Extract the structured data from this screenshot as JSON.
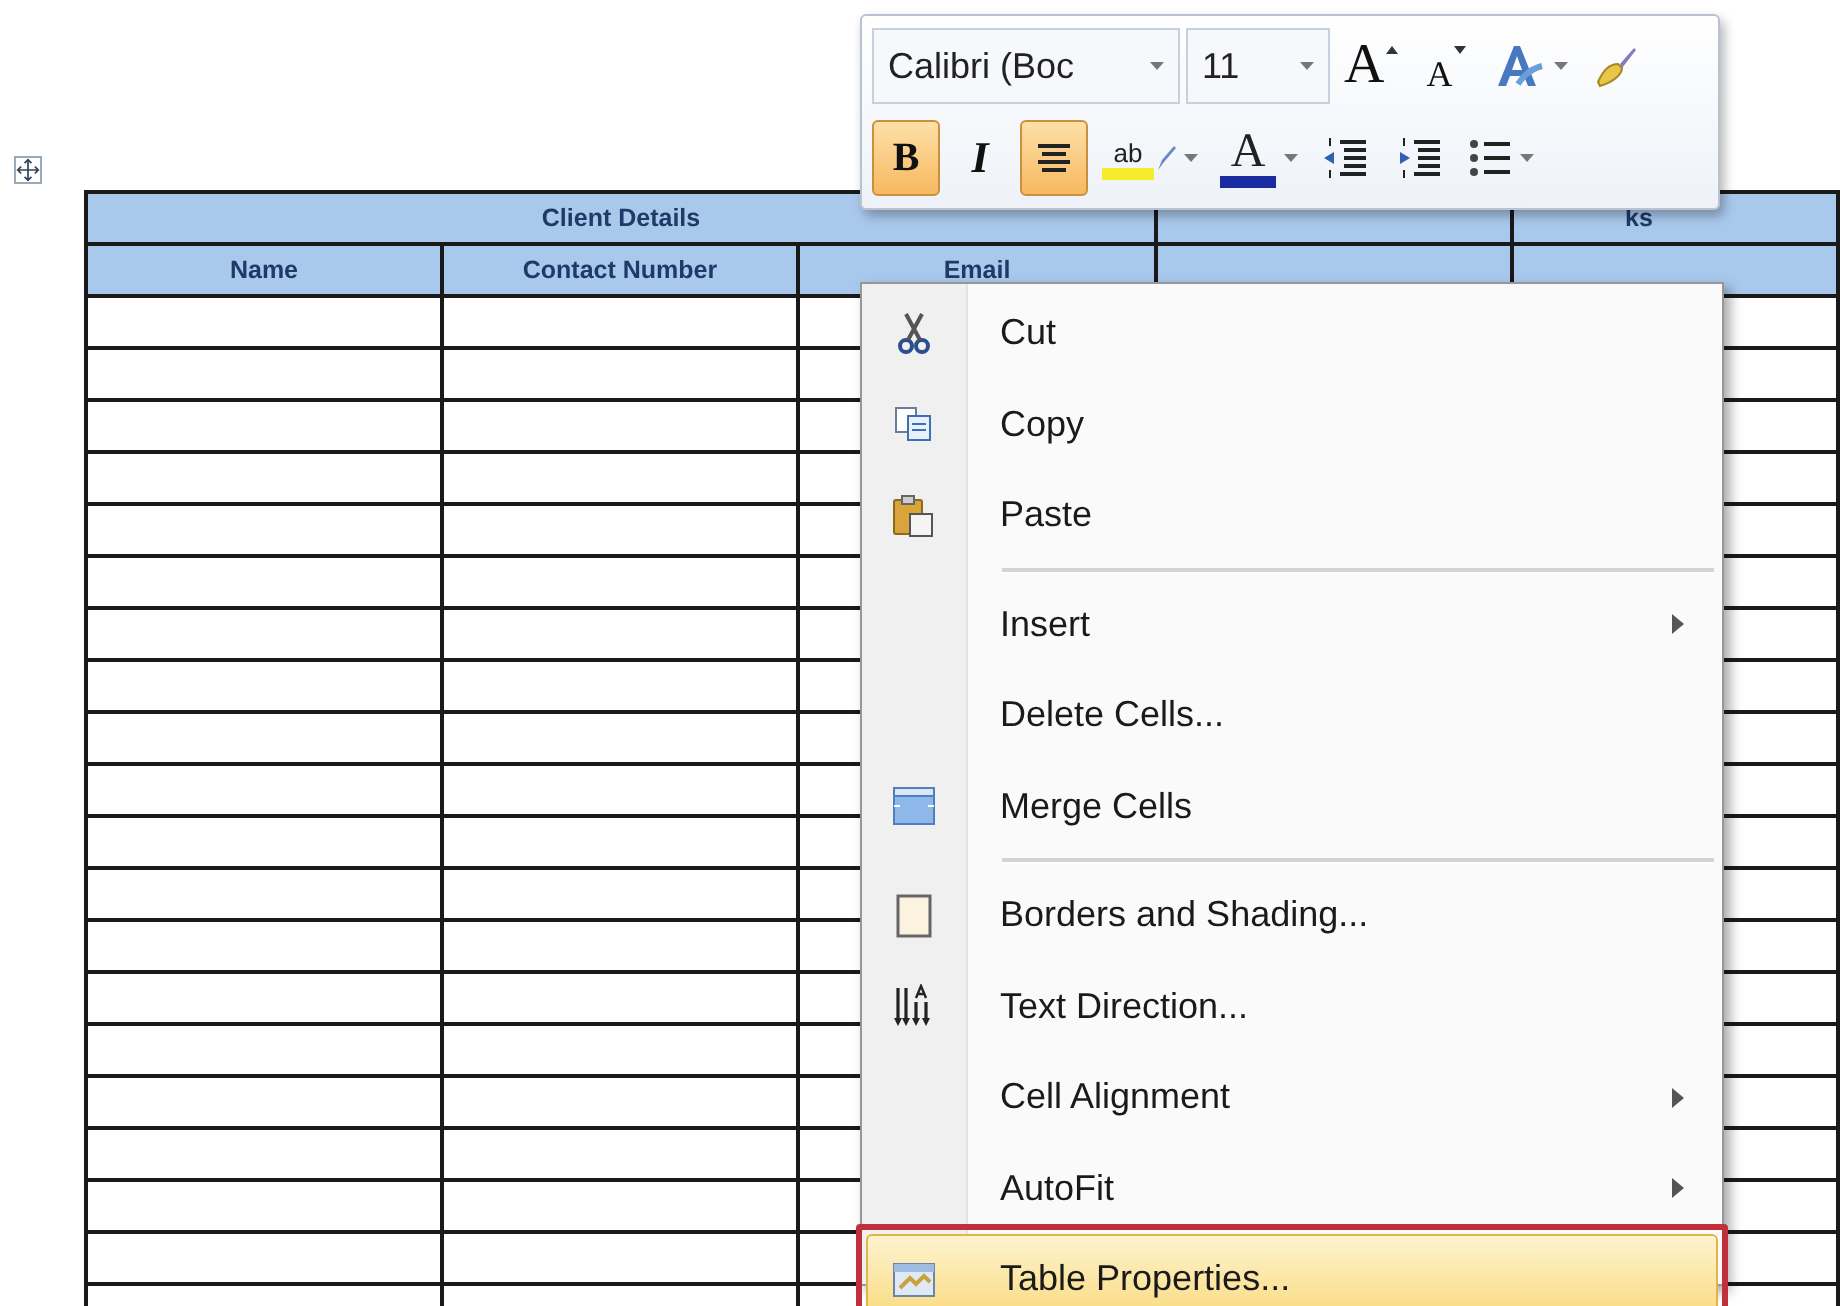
{
  "table": {
    "group_header": [
      {
        "kind": "group",
        "label": "Client Details"
      },
      {
        "kind": "single"
      },
      {
        "kind": "single",
        "label": "ks"
      }
    ],
    "columns": [
      "Name",
      "Contact Number",
      "Email",
      null,
      null
    ]
  },
  "mini_toolbar": {
    "font": {
      "value": "Calibri (Boc"
    },
    "size": {
      "value": "11"
    },
    "row1": [
      {
        "kind": "grow-font",
        "label": "A",
        "selected": false
      },
      {
        "kind": "shrink-font",
        "label": "A",
        "selected": false
      },
      {
        "kind": "styles",
        "selected": false
      },
      {
        "kind": "format-painter",
        "selected": false
      }
    ],
    "row2": [
      {
        "kind": "bold",
        "label": "B",
        "selected": true
      },
      {
        "kind": "italic",
        "label": "I",
        "selected": false
      },
      {
        "kind": "center",
        "selected": true
      },
      {
        "kind": "highlight",
        "label": "ab",
        "selected": false
      },
      {
        "kind": "font-color",
        "label": "A",
        "selected": false
      },
      {
        "kind": "outdent",
        "selected": false
      },
      {
        "kind": "indent",
        "selected": false
      },
      {
        "kind": "bullets",
        "selected": false
      }
    ]
  },
  "context_menu": {
    "items": [
      {
        "kind": "item",
        "label": "Cut",
        "submenu": false,
        "selected": false
      },
      {
        "kind": "item",
        "label": "Copy",
        "submenu": false,
        "selected": false
      },
      {
        "kind": "item",
        "label": "Paste",
        "submenu": false,
        "selected": false
      },
      {
        "kind": "separator"
      },
      {
        "kind": "item",
        "label": "Insert",
        "submenu": true,
        "selected": false
      },
      {
        "kind": "item",
        "label": "Delete Cells...",
        "submenu": false,
        "selected": false
      },
      {
        "kind": "item",
        "label": "Merge Cells",
        "submenu": false,
        "selected": false
      },
      {
        "kind": "separator"
      },
      {
        "kind": "item",
        "label": "Borders and Shading...",
        "submenu": false,
        "selected": false
      },
      {
        "kind": "item",
        "label": "Text Direction...",
        "submenu": false,
        "selected": false
      },
      {
        "kind": "item",
        "label": "Cell Alignment",
        "submenu": true,
        "selected": false
      },
      {
        "kind": "item",
        "label": "AutoFit",
        "submenu": true,
        "selected": false
      },
      {
        "kind": "item",
        "label": "Table Properties...",
        "submenu": false,
        "selected": true,
        "outlined": true
      }
    ]
  }
}
